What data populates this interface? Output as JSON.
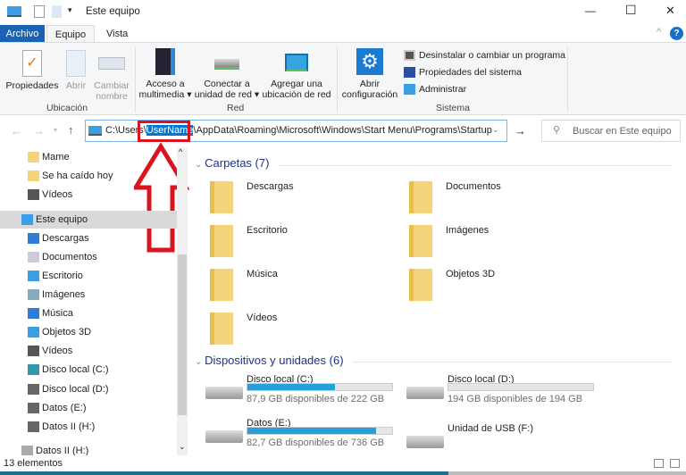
{
  "window": {
    "title": "Este equipo",
    "minimize": "—",
    "maximize": "☐",
    "close": "✕",
    "help": "?"
  },
  "tabs": [
    {
      "label": "Archivo"
    },
    {
      "label": "Equipo"
    },
    {
      "label": "Vista"
    }
  ],
  "ribbon": {
    "ubicacion": {
      "label": "Ubicación",
      "propiedades": "Propiedades",
      "abrir": "Abrir",
      "cambiar1": "Cambiar",
      "cambiar2": "nombre"
    },
    "red": {
      "label": "Red",
      "acceso1": "Acceso a",
      "acceso2": "multimedia ▾",
      "conectar1": "Conectar a",
      "conectar2": "unidad de red ▾",
      "agregar1": "Agregar una",
      "agregar2": "ubicación de red"
    },
    "sistema": {
      "label": "Sistema",
      "abrir1": "Abrir",
      "abrir2": "configuración",
      "desinstalar": "Desinstalar o cambiar un programa",
      "propiedades": "Propiedades del sistema",
      "administrar": "Administrar"
    }
  },
  "address": {
    "prefix": "C:\\Users\\",
    "highlight": "UserName",
    "suffix": "\\AppData\\Roaming\\Microsoft\\Windows\\Start Menu\\Programs\\Startup"
  },
  "search": {
    "placeholder": "Buscar en Este equipo"
  },
  "nav": [
    "Mame",
    "Se ha caído hoy",
    "Vídeos",
    "Este equipo",
    "Descargas",
    "Documentos",
    "Escritorio",
    "Imágenes",
    "Música",
    "Objetos 3D",
    "Vídeos",
    "Disco local (C:)",
    "Disco local (D:)",
    "Datos (E:)",
    "Datos II (H:)",
    "Datos II (H:)"
  ],
  "folders_header": "Carpetas (7)",
  "folders": [
    "Descargas",
    "Documentos",
    "Escritorio",
    "Imágenes",
    "Música",
    "Objetos 3D",
    "Vídeos"
  ],
  "devices_header": "Dispositivos y unidades (6)",
  "drives": [
    {
      "name": "Disco local (C:)",
      "free": "87,9 GB disponibles de 222 GB",
      "used_pct": 60.4
    },
    {
      "name": "Disco local (D:)",
      "free": "194 GB disponibles de 194 GB",
      "used_pct": 0
    },
    {
      "name": "Datos (E:)",
      "free": "82,7 GB disponibles de 736 GB",
      "used_pct": 88.8
    },
    {
      "name": "Unidad de USB (F:)"
    }
  ],
  "status": "13 elementos",
  "colors": {
    "accent": "#0063b1",
    "annotation": "#d9141e",
    "bar": "#26a0da"
  }
}
